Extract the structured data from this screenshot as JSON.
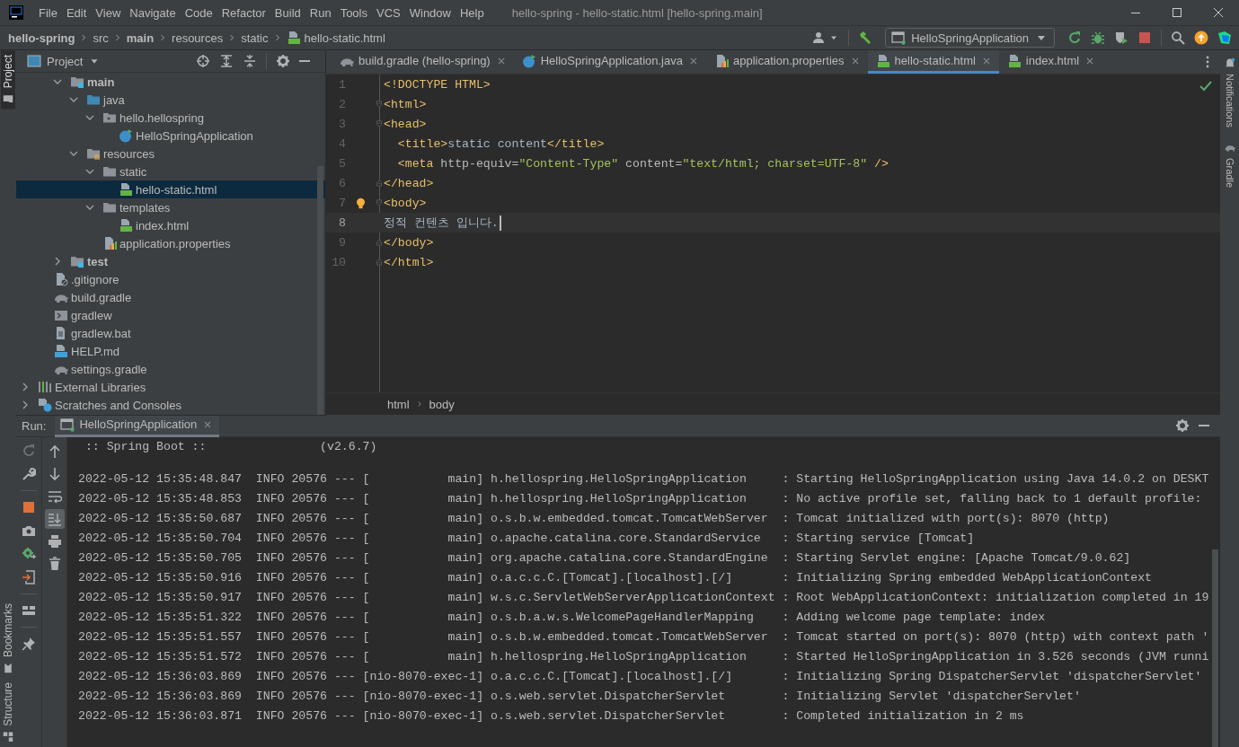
{
  "menu": [
    "File",
    "Edit",
    "View",
    "Navigate",
    "Code",
    "Refactor",
    "Build",
    "Run",
    "Tools",
    "VCS",
    "Window",
    "Help"
  ],
  "window": {
    "title": "hello-spring - hello-static.html [hello-spring.main]"
  },
  "breadcrumbs": [
    {
      "label": "hello-spring",
      "bold": true
    },
    {
      "label": "src",
      "bold": false
    },
    {
      "label": "main",
      "bold": true
    },
    {
      "label": "resources",
      "bold": false
    },
    {
      "label": "static",
      "bold": false
    },
    {
      "label": "hello-static.html",
      "bold": false,
      "kind": "html"
    }
  ],
  "run_config": "HelloSpringApplication",
  "left_stripe": [
    {
      "label": "Project",
      "selected": true,
      "at_bottom": false,
      "kind": "stripe-folder"
    },
    {
      "label": "Bookmarks",
      "selected": false,
      "at_bottom": true,
      "kind": "bookmark"
    },
    {
      "label": "Structure",
      "selected": false,
      "at_bottom": true,
      "kind": "structure"
    }
  ],
  "right_stripe": [
    {
      "label": "Notifications",
      "kind": "bell"
    },
    {
      "label": "Gradle",
      "kind": "gradle"
    }
  ],
  "project_panel": {
    "title": "Project"
  },
  "tree": [
    {
      "children": [
        {
          "children": [
            {
              "label": "main",
              "kind": "source-root",
              "expanded": true,
              "selected": false,
              "children": [
                {
                  "label": "java",
                  "kind": "java-root",
                  "expanded": true,
                  "selected": false,
                  "children": [
                    {
                      "label": "hello.hellospring",
                      "kind": "package",
                      "expanded": true,
                      "selected": false,
                      "children": [
                        {
                          "label": "HelloSpringApplication",
                          "kind": "class",
                          "selected": false
                        }
                      ]
                    }
                  ]
                },
                {
                  "label": "resources",
                  "kind": "resources",
                  "expanded": true,
                  "selected": false,
                  "children": [
                    {
                      "label": "static",
                      "kind": "folder",
                      "expanded": true,
                      "selected": false,
                      "children": [
                        {
                          "label": "hello-static.html",
                          "kind": "html",
                          "selected": true
                        }
                      ]
                    },
                    {
                      "label": "templates",
                      "kind": "folder",
                      "expanded": true,
                      "selected": false,
                      "children": [
                        {
                          "label": "index.html",
                          "kind": "html",
                          "selected": false
                        }
                      ]
                    },
                    {
                      "label": "application.properties",
                      "kind": "properties",
                      "selected": false
                    }
                  ]
                }
              ]
            },
            {
              "label": "test",
              "kind": "source-root",
              "expanded": false,
              "selected": false
            }
          ]
        },
        {
          "label": ".gitignore",
          "kind": "gitignore",
          "selected": false
        },
        {
          "label": "build.gradle",
          "kind": "gradle",
          "selected": false
        },
        {
          "label": "gradlew",
          "kind": "shell",
          "selected": false
        },
        {
          "label": "gradlew.bat",
          "kind": "bat",
          "selected": false
        },
        {
          "label": "HELP.md",
          "kind": "markdown",
          "selected": false
        },
        {
          "label": "settings.gradle",
          "kind": "gradle",
          "selected": false
        }
      ]
    },
    {
      "label": "External Libraries",
      "kind": "libraries",
      "expanded": false,
      "selected": false
    },
    {
      "label": "Scratches and Consoles",
      "kind": "scratches",
      "expanded": false,
      "selected": false
    }
  ],
  "editor": {
    "tabs": [
      {
        "label": "build.gradle (hello-spring)",
        "kind": "gradle",
        "selected": false
      },
      {
        "label": "HelloSpringApplication.java",
        "kind": "class",
        "selected": false
      },
      {
        "label": "application.properties",
        "kind": "properties",
        "selected": false
      },
      {
        "label": "hello-static.html",
        "kind": "html",
        "selected": true
      },
      {
        "label": "index.html",
        "kind": "html",
        "selected": false
      }
    ],
    "lines": [
      {
        "number": "1",
        "fold_start": false,
        "fold_end": false,
        "current": false,
        "bulb": false,
        "tokens": [
          {
            "kind": "tag",
            "text": "<!DOCTYPE HTML>"
          }
        ]
      },
      {
        "number": "2",
        "fold_start": true,
        "fold_end": false,
        "current": false,
        "bulb": false,
        "tokens": [
          {
            "kind": "tag",
            "text": "<html>"
          }
        ]
      },
      {
        "number": "3",
        "fold_start": true,
        "fold_end": false,
        "current": false,
        "bulb": false,
        "tokens": [
          {
            "kind": "tag",
            "text": "<head>"
          }
        ]
      },
      {
        "number": "4",
        "fold_start": false,
        "fold_end": false,
        "current": false,
        "bulb": false,
        "tokens": [
          {
            "kind": "tag",
            "text": "  <title>"
          },
          {
            "kind": "text",
            "text": "static content"
          },
          {
            "kind": "tag",
            "text": "</title>"
          }
        ]
      },
      {
        "number": "5",
        "fold_start": false,
        "fold_end": false,
        "current": false,
        "bulb": false,
        "tokens": [
          {
            "kind": "tag",
            "text": "  <meta"
          },
          {
            "kind": "attr",
            "text": " http-equiv="
          },
          {
            "kind": "string",
            "text": "\"Content-Type\""
          },
          {
            "kind": "attr",
            "text": " content="
          },
          {
            "kind": "string",
            "text": "\"text/html; charset=UTF-8\""
          },
          {
            "kind": "tag",
            "text": " />"
          }
        ]
      },
      {
        "number": "6",
        "fold_start": false,
        "fold_end": true,
        "current": false,
        "bulb": false,
        "tokens": [
          {
            "kind": "tag",
            "text": "</head>"
          }
        ]
      },
      {
        "number": "7",
        "fold_start": true,
        "fold_end": false,
        "current": false,
        "bulb": true,
        "tokens": [
          {
            "kind": "tag",
            "text": "<body>"
          }
        ]
      },
      {
        "number": "8",
        "fold_start": false,
        "fold_end": false,
        "current": true,
        "bulb": false,
        "tokens": [
          {
            "kind": "text",
            "text": "정적 컨텐츠 입니다."
          }
        ]
      },
      {
        "number": "9",
        "fold_start": false,
        "fold_end": true,
        "current": false,
        "bulb": false,
        "tokens": [
          {
            "kind": "tag",
            "text": "</body>"
          }
        ]
      },
      {
        "number": "10",
        "fold_start": false,
        "fold_end": true,
        "current": false,
        "bulb": false,
        "tokens": [
          {
            "kind": "tag",
            "text": "</html>"
          }
        ]
      }
    ],
    "breadcrumbs": [
      "html",
      "body"
    ]
  },
  "run": {
    "label": "Run:",
    "tabs": [
      {
        "label": "HelloSpringApplication",
        "selected": true
      }
    ],
    "tools": [
      {
        "kind": "up",
        "on": false
      },
      {
        "kind": "down",
        "on": false
      },
      {
        "kind": "wrap",
        "on": false
      },
      {
        "kind": "scroll-end",
        "on": true
      },
      {
        "kind": "print",
        "on": false
      },
      {
        "kind": "trash",
        "on": false
      }
    ],
    "console": [
      {
        "kind": "banner",
        "text": " :: Spring Boot ::                (v2.6.7)"
      },
      {
        "kind": "log",
        "text": "2022-05-12 15:35:48.847  INFO 20576 --- [           main] h.hellospring.HelloSpringApplication     : Starting HelloSpringApplication using Java 14.0.2 on DESKT"
      },
      {
        "kind": "log",
        "text": "2022-05-12 15:35:48.853  INFO 20576 --- [           main] h.hellospring.HelloSpringApplication     : No active profile set, falling back to 1 default profile:"
      },
      {
        "kind": "log",
        "text": "2022-05-12 15:35:50.687  INFO 20576 --- [           main] o.s.b.w.embedded.tomcat.TomcatWebServer  : Tomcat initialized with port(s): 8070 (http)"
      },
      {
        "kind": "log",
        "text": "2022-05-12 15:35:50.704  INFO 20576 --- [           main] o.apache.catalina.core.StandardService   : Starting service [Tomcat]"
      },
      {
        "kind": "log",
        "text": "2022-05-12 15:35:50.705  INFO 20576 --- [           main] org.apache.catalina.core.StandardEngine  : Starting Servlet engine: [Apache Tomcat/9.0.62]"
      },
      {
        "kind": "log",
        "text": "2022-05-12 15:35:50.916  INFO 20576 --- [           main] o.a.c.c.C.[Tomcat].[localhost].[/]       : Initializing Spring embedded WebApplicationContext"
      },
      {
        "kind": "log",
        "text": "2022-05-12 15:35:50.917  INFO 20576 --- [           main] w.s.c.ServletWebServerApplicationContext : Root WebApplicationContext: initialization completed in 19"
      },
      {
        "kind": "log",
        "text": "2022-05-12 15:35:51.322  INFO 20576 --- [           main] o.s.b.a.w.s.WelcomePageHandlerMapping    : Adding welcome page template: index"
      },
      {
        "kind": "log",
        "text": "2022-05-12 15:35:51.557  INFO 20576 --- [           main] o.s.b.w.embedded.tomcat.TomcatWebServer  : Tomcat started on port(s): 8070 (http) with context path '"
      },
      {
        "kind": "log",
        "text": "2022-05-12 15:35:51.572  INFO 20576 --- [           main] h.hellospring.HelloSpringApplication     : Started HelloSpringApplication in 3.526 seconds (JVM runni"
      },
      {
        "kind": "log",
        "text": "2022-05-12 15:36:03.869  INFO 20576 --- [nio-8070-exec-1] o.a.c.c.C.[Tomcat].[localhost].[/]       : Initializing Spring DispatcherServlet 'dispatcherServlet'"
      },
      {
        "kind": "log",
        "text": "2022-05-12 15:36:03.869  INFO 20576 --- [nio-8070-exec-1] o.s.web.servlet.DispatcherServlet        : Initializing Servlet 'dispatcherServlet'"
      },
      {
        "kind": "log",
        "text": "2022-05-12 15:36:03.871  INFO 20576 --- [nio-8070-exec-1] o.s.web.servlet.DispatcherServlet        : Completed initialization in 2 ms"
      }
    ]
  }
}
